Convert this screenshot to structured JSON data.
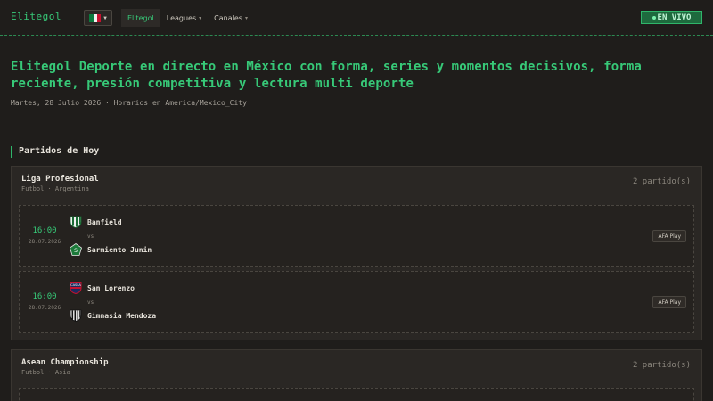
{
  "header": {
    "brand": "Elitegol",
    "nav": [
      {
        "label": "Elitegol",
        "active": true,
        "has_caret": false
      },
      {
        "label": "Leagues",
        "active": false,
        "has_caret": true
      },
      {
        "label": "Canales",
        "active": false,
        "has_caret": true
      }
    ],
    "live_label": "EN VIVO",
    "flag_icon": "mexico-flag-icon"
  },
  "hero": {
    "title": "Elitegol Deporte en directo en México con forma, series y momentos decisivos, forma reciente, presión competitiva y lectura multi deporte",
    "subtitle": "Martes, 28 Julio 2026 · Horarios en America/Mexico_City"
  },
  "section": {
    "title": "Partidos de Hoy"
  },
  "leagues": [
    {
      "name": "Liga Profesional",
      "meta": "Futbol · Argentina",
      "count": "2 partido(s)",
      "matches": [
        {
          "time": "16:00",
          "date": "28.07.2026",
          "home": "Banfield",
          "away": "Sarmiento Junin",
          "vs": "vs",
          "channel": "AFA Play"
        },
        {
          "time": "16:00",
          "date": "28.07.2026",
          "home": "San Lorenzo",
          "away": "Gimnasia Mendoza",
          "vs": "vs",
          "channel": "AFA Play"
        }
      ]
    },
    {
      "name": "Asean Championship",
      "meta": "Futbol · Asia",
      "count": "2 partido(s)",
      "matches": []
    }
  ],
  "colors": {
    "accent": "#37c978",
    "background": "#1f1d1b",
    "card": "#2a2724"
  }
}
